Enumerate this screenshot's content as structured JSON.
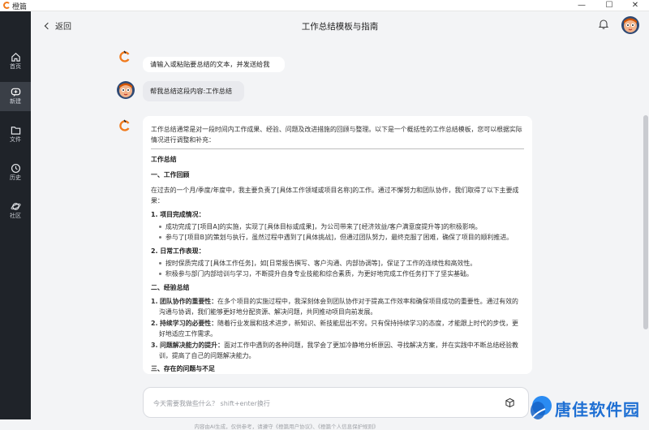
{
  "window": {
    "app_name": "橙篇",
    "minimize": "—",
    "maximize": "☐",
    "close": "✕"
  },
  "sidebar": {
    "items": [
      {
        "label": "首页",
        "icon": "home-icon"
      },
      {
        "label": "新建",
        "icon": "new-chat-icon"
      },
      {
        "label": "文件",
        "icon": "folder-icon"
      },
      {
        "label": "历史",
        "icon": "history-icon"
      },
      {
        "label": "社区",
        "icon": "planet-icon"
      }
    ],
    "active": "新建"
  },
  "header": {
    "back_label": "返回",
    "title": "工作总结模板与指南"
  },
  "chat": {
    "bot_greeting": "请输入或粘贴要总结的文本，并发送给我",
    "user_message": "帮我总结这段内容:工作总结",
    "answer": {
      "intro": "工作总结通常是对一段时间内工作成果、经验、问题及改进措施的回顾与整理。以下是一个概括性的工作总结模板，您可以根据实际情况进行调整和补充：",
      "title": "工作总结",
      "s1_title": "一、工作回顾",
      "s1_intro": "在过去的一个月/季度/年度中，我主要负责了[具体工作领域或项目名称]的工作。通过不懈努力和团队协作，我们取得了以下主要成果：",
      "p1_title": "1. 项目完成情况：",
      "p1_items": [
        "成功完成了[项目A]的实施，实现了[具体目标或成果]，为公司带来了[经济效益/客户满意度提升等]的积极影响。",
        "参与了[项目B]的策划与执行，虽然过程中遇到了[具体挑战]，但通过团队努力，最终克服了困难，确保了项目的顺利推进。"
      ],
      "p2_title": "2. 日常工作表现：",
      "p2_items": [
        "按时保质完成了[具体工作任务]，如[日常报告撰写、客户沟通、内部协调等]，保证了工作的连续性和高效性。",
        "积极参与部门内部培训与学习，不断提升自身专业技能和综合素质，为更好地完成工作任务打下了坚实基础。"
      ],
      "s2_title": "二、经验总结",
      "s2_items": [
        {
          "num": "1.",
          "bold": "团队协作的重要性：",
          "text": "在多个项目的实施过程中，我深刻体会到团队协作对于提高工作效率和确保项目成功的重要性。通过有效的沟通与协调，我们能够更好地分配资源、解决问题，共同推动项目向前发展。"
        },
        {
          "num": "2.",
          "bold": "持续学习的必要性：",
          "text": "随着行业发展和技术进步，新知识、新技能层出不穷。只有保持持续学习的态度，才能跟上时代的步伐，更好地适应工作需求。"
        },
        {
          "num": "3.",
          "bold": "问题解决能力的提升：",
          "text": "面对工作中遇到的各种问题，我学会了更加冷静地分析原因、寻找解决方案，并在实践中不断总结经验教训，提高了自己的问题解决能力。"
        }
      ],
      "s3_partial": "三、存在的问题与不足"
    }
  },
  "input": {
    "placeholder": "今天需要我做些什么？ shift+enter换行"
  },
  "footer": {
    "disclaimer": "内容由AI生成，仅供参考，请遵守《橙篇用户协议》、《橙篇个人信息保护规则》"
  },
  "watermark": {
    "text": "唐佳软件园"
  }
}
